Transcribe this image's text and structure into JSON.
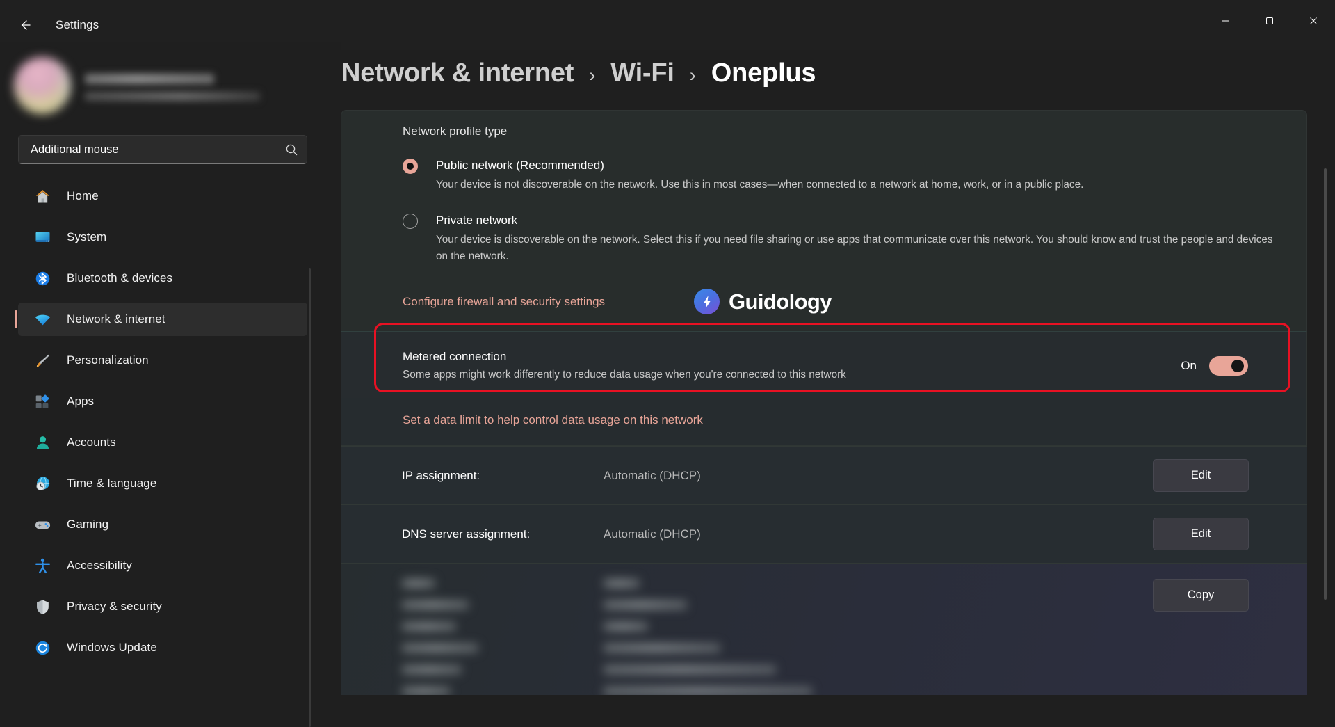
{
  "window": {
    "title": "Settings",
    "back_icon": "back-arrow-icon",
    "minimize_label": "–",
    "maximize_label": "☐",
    "close_label": "✕"
  },
  "sidebar": {
    "search": {
      "value": "Additional mouse",
      "placeholder": "Find a setting",
      "icon": "search-icon"
    },
    "items": [
      {
        "label": "Home",
        "icon": "home-icon",
        "active": false
      },
      {
        "label": "System",
        "icon": "system-monitor-icon",
        "active": false
      },
      {
        "label": "Bluetooth & devices",
        "icon": "bluetooth-icon",
        "active": false
      },
      {
        "label": "Network & internet",
        "icon": "wifi-icon",
        "active": true
      },
      {
        "label": "Personalization",
        "icon": "paintbrush-icon",
        "active": false
      },
      {
        "label": "Apps",
        "icon": "apps-icon",
        "active": false
      },
      {
        "label": "Accounts",
        "icon": "person-icon",
        "active": false
      },
      {
        "label": "Time & language",
        "icon": "clock-globe-icon",
        "active": false
      },
      {
        "label": "Gaming",
        "icon": "gamepad-icon",
        "active": false
      },
      {
        "label": "Accessibility",
        "icon": "accessibility-icon",
        "active": false
      },
      {
        "label": "Privacy & security",
        "icon": "shield-icon",
        "active": false
      },
      {
        "label": "Windows Update",
        "icon": "update-refresh-icon",
        "active": false
      }
    ]
  },
  "breadcrumb": {
    "separator": "›",
    "items": [
      {
        "label": "Network & internet",
        "current": false
      },
      {
        "label": "Wi-Fi",
        "current": false
      },
      {
        "label": "Oneplus",
        "current": true
      }
    ]
  },
  "main": {
    "profile_section": {
      "title": "Network profile type",
      "options": [
        {
          "label": "Public network (Recommended)",
          "description": "Your device is not discoverable on the network. Use this in most cases—when connected to a network at home, work, or in a public place.",
          "selected": true
        },
        {
          "label": "Private network",
          "description": "Your device is discoverable on the network. Select this if you need file sharing or use apps that communicate over this network. You should know and trust the people and devices on the network.",
          "selected": false
        }
      ],
      "firewall_link": "Configure firewall and security settings"
    },
    "watermark": {
      "text": "Guidology",
      "icon": "lightning-bolt-icon"
    },
    "metered": {
      "title": "Metered connection",
      "description": "Some apps might work differently to reduce data usage when you're connected to this network",
      "toggle_state": "On",
      "toggle_on": true,
      "highlighted": true,
      "data_limit_link": "Set a data limit to help control data usage on this network"
    },
    "rows": [
      {
        "label": "IP assignment:",
        "value": "Automatic (DHCP)",
        "button": "Edit"
      },
      {
        "label": "DNS server assignment:",
        "value": "Automatic (DHCP)",
        "button": "Edit"
      }
    ],
    "properties_row": {
      "button": "Copy",
      "redacted": true
    }
  },
  "colors": {
    "accent": "#e8a598",
    "highlight_box": "#e81123",
    "window_bg": "#1f1f1f",
    "panel_bg": "#282d2c"
  }
}
